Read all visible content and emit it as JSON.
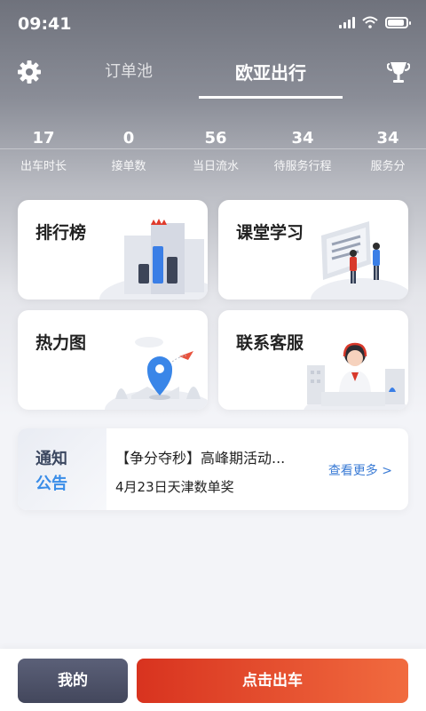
{
  "status": {
    "time": "09:41"
  },
  "nav": {
    "tab_inactive": "订单池",
    "tab_active": "欧亚出行",
    "left_icon": "gear-icon",
    "right_icon": "trophy-icon"
  },
  "stats": [
    {
      "value": "17",
      "label": "出车时长"
    },
    {
      "value": "0",
      "label": "接单数"
    },
    {
      "value": "56",
      "label": "当日流水"
    },
    {
      "value": "34",
      "label": "待服务行程"
    },
    {
      "value": "34",
      "label": "服务分"
    }
  ],
  "cards": {
    "ranking": "排行榜",
    "study": "课堂学习",
    "heatmap": "热力图",
    "service": "联系客服"
  },
  "notice": {
    "badge_line1": "通知",
    "badge_line2": "公告",
    "title": "【争分夺秒】高峰期活动...",
    "subtitle": "4月23日天津数单奖",
    "more": "查看更多 >"
  },
  "bottom": {
    "mine": "我的",
    "go": "点击出车"
  },
  "colors": {
    "accent_blue": "#3a8de8",
    "go_button_start": "#d8331f",
    "go_button_end": "#f16b3f",
    "mine_button": "#4b5066"
  }
}
